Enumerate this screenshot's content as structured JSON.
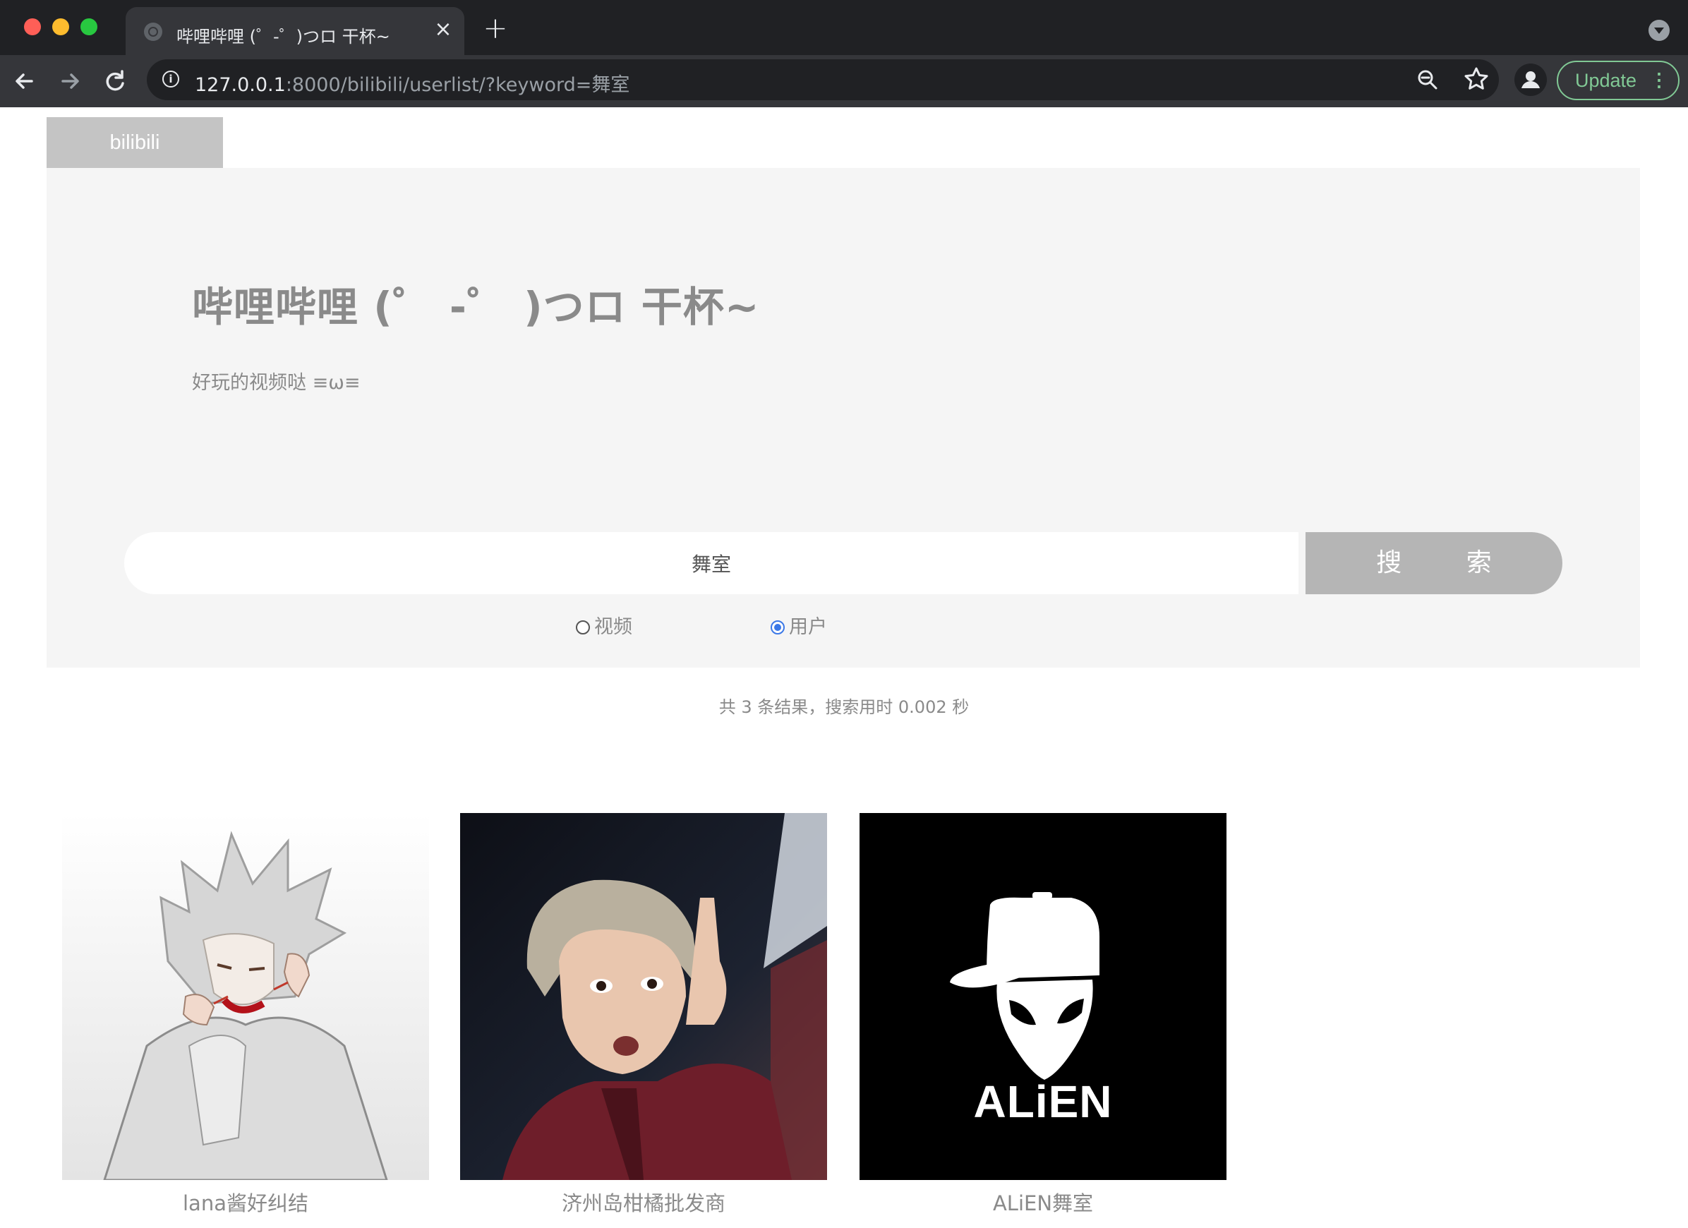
{
  "browser": {
    "tab_title": "哔哩哔哩 (゜-゜)つロ 干杯~",
    "url_host": "127.0.0.1",
    "url_rest": ":8000/bilibili/userlist/?keyword=舞室",
    "update_label": "Update"
  },
  "page": {
    "brand": "bilibili",
    "title": "哔哩哔哩 (゜ -゜ )つロ 干杯~",
    "subtitle": "好玩的视频哒 ≡ω≡"
  },
  "search": {
    "value": "舞室",
    "button_label": "搜 索",
    "options": [
      {
        "label": "视频",
        "checked": false
      },
      {
        "label": "用户",
        "checked": true
      }
    ],
    "result_info": "共 3 条结果，搜索用时 0.002 秒"
  },
  "results": [
    {
      "name": "lana酱好纠结"
    },
    {
      "name": "济州岛柑橘批发商"
    },
    {
      "name": "ALiEN舞室",
      "logo_text": "ALiEN"
    }
  ]
}
